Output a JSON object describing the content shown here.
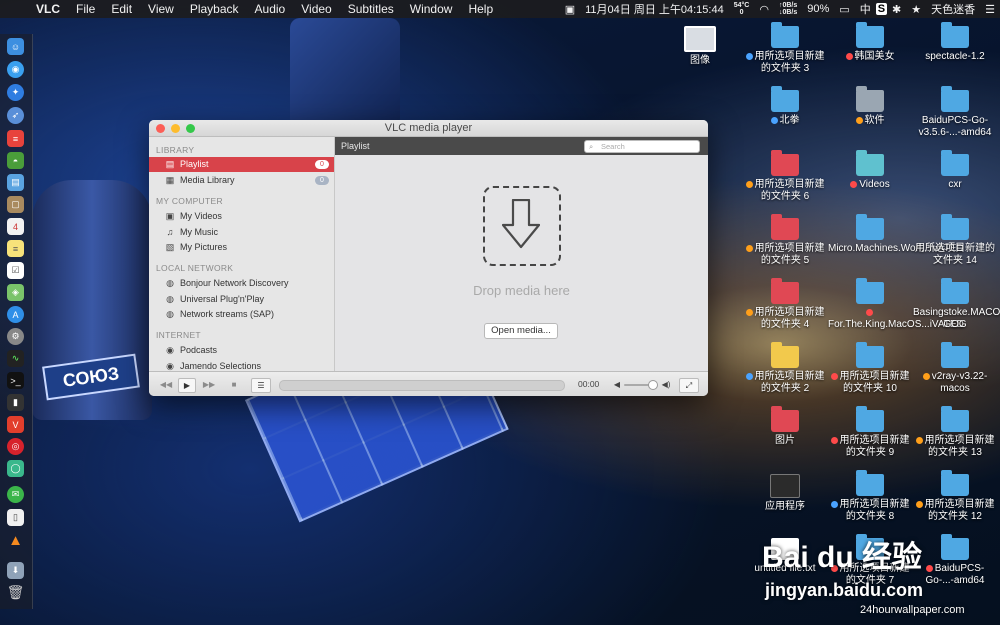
{
  "menubar": {
    "apple": "",
    "app": "VLC",
    "items": [
      "File",
      "Edit",
      "View",
      "Playback",
      "Audio",
      "Video",
      "Subtitles",
      "Window",
      "Help"
    ],
    "temp": "54°C",
    "temp_sub": "0",
    "net_up": "↑0B/s",
    "net_down": "↓0B/s",
    "datetime": "11月04日 周日 上午04:15:44",
    "battery": "90%",
    "input": "中",
    "s_icon": "S",
    "user": "天色迷香"
  },
  "vlc": {
    "title": "VLC media player",
    "sidebar": {
      "library_header": "LIBRARY",
      "playlist": "Playlist",
      "playlist_count": "0",
      "media_library": "Media Library",
      "media_library_count": "0",
      "computer_header": "MY COMPUTER",
      "my_videos": "My Videos",
      "my_music": "My Music",
      "my_pictures": "My Pictures",
      "local_header": "LOCAL NETWORK",
      "bonjour": "Bonjour Network Discovery",
      "upnp": "Universal Plug'n'Play",
      "sap": "Network streams (SAP)",
      "internet_header": "INTERNET",
      "podcasts": "Podcasts",
      "jamendo": "Jamendo Selections"
    },
    "main": {
      "header": "Playlist",
      "search_placeholder": "Search",
      "drop_text": "Drop media here",
      "open_button": "Open media..."
    },
    "controls": {
      "rewind": "◀◀",
      "play": "▶",
      "forward": "▶▶",
      "stop": "■",
      "playlist_toggle": "☰",
      "time": "00:00",
      "progress": 0,
      "volume": 0.8,
      "fullscreen": "⤢"
    }
  },
  "desktop": {
    "icons": [
      {
        "label": "图像",
        "kind": "image"
      },
      {
        "label": "用所选项目新建的文件夹 3",
        "kind": "folder",
        "tag": "#4aa3ff"
      },
      {
        "label": "韩国美女",
        "kind": "folder",
        "tag": "#ff4a4a"
      },
      {
        "label": "spectacle-1.2",
        "kind": "folder"
      },
      {
        "label": "北拳",
        "kind": "folder",
        "tag": "#4aa3ff"
      },
      {
        "label": "软件",
        "kind": "folder-grey",
        "tag": "#ff9f1a"
      },
      {
        "label": "BaiduPCS-Go-v3.5.6-...-amd64",
        "kind": "folder"
      },
      {
        "label": "用所选项目新建的文件夹 6",
        "kind": "folder-red",
        "tag": "#ff9f1a"
      },
      {
        "label": "Videos",
        "kind": "folder-teal",
        "tag": "#ff4a4a"
      },
      {
        "label": "cxr",
        "kind": "folder"
      },
      {
        "label": "用所选项目新建的文件夹 5",
        "kind": "folder-red",
        "tag": "#ff9f1a"
      },
      {
        "label": "Micro.Machines.Worl...iVATED",
        "kind": "folder"
      },
      {
        "label": "用所选项目新建的文件夹 14",
        "kind": "folder"
      },
      {
        "label": "用所选项目新建的文件夹 4",
        "kind": "folder-red",
        "tag": "#ff9f1a"
      },
      {
        "label": "For.The.King.MacOS...iVATED",
        "kind": "folder",
        "tag": "#ff4a4a"
      },
      {
        "label": "Basingstoke.MACOSX-GOG",
        "kind": "folder"
      },
      {
        "label": "用所选项目新建的文件夹 2",
        "kind": "folder-yellow",
        "tag": "#4aa3ff"
      },
      {
        "label": "用所选项目新建的文件夹 10",
        "kind": "folder",
        "tag": "#ff4a4a"
      },
      {
        "label": "v2ray-v3.22-macos",
        "kind": "folder",
        "tag": "#ff9f1a"
      },
      {
        "label": "图片",
        "kind": "folder-red"
      },
      {
        "label": "用所选项目新建的文件夹 9",
        "kind": "folder",
        "tag": "#ff4a4a"
      },
      {
        "label": "用所选项目新建的文件夹 13",
        "kind": "folder",
        "tag": "#ff9f1a"
      },
      {
        "label": "应用程序",
        "kind": "terminal"
      },
      {
        "label": "用所选项目新建的文件夹 8",
        "kind": "folder",
        "tag": "#4aa3ff"
      },
      {
        "label": "用所选项目新建的文件夹 12",
        "kind": "folder",
        "tag": "#ff9f1a"
      },
      {
        "label": "untitled file.txt",
        "kind": "text"
      },
      {
        "label": "用所选项目新建的文件夹 7",
        "kind": "folder",
        "tag": "#ff4a4a"
      },
      {
        "label": "BaiduPCS-Go-...-amd64",
        "kind": "folder",
        "tag": "#ff4a4a"
      }
    ],
    "soyuz_label": "СОЮЗ",
    "watermark_1": "Bai du 经验",
    "watermark_2": "jingyan.baidu.com",
    "watermark_3": "24hourwallpaper.com"
  }
}
